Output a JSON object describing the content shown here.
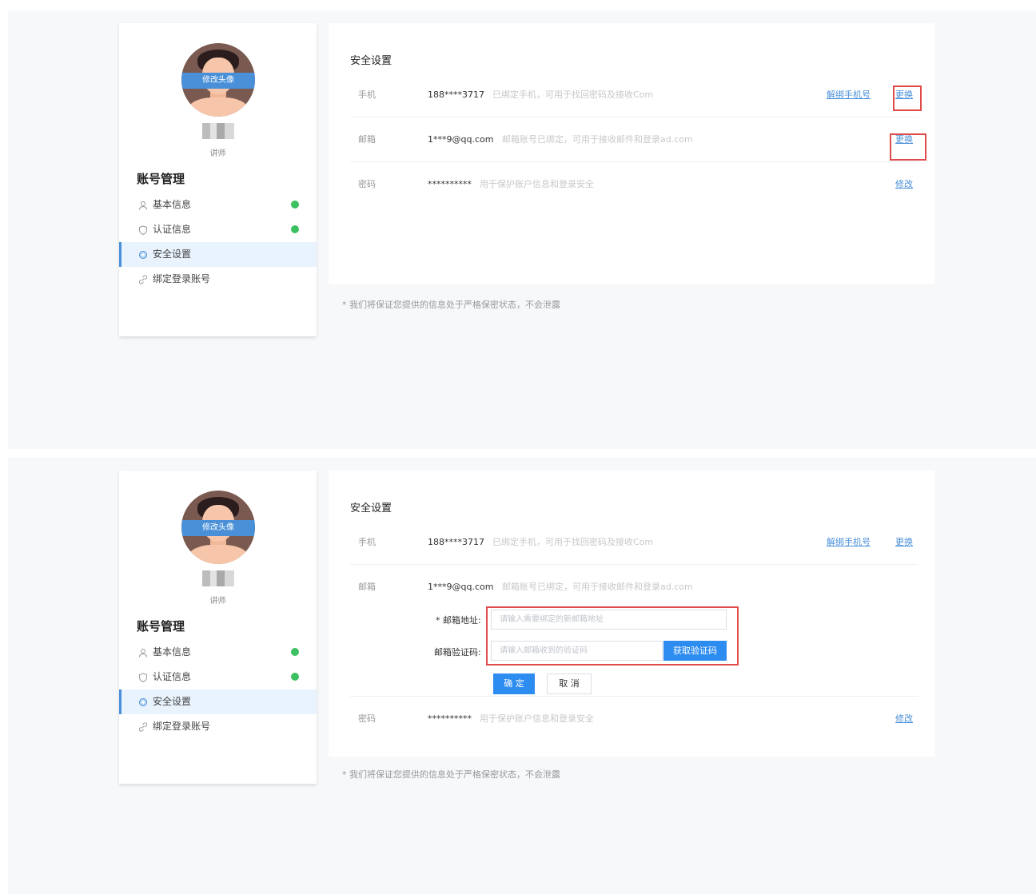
{
  "sidebar": {
    "avatar_badge": "修改头像",
    "name_sub": "讲师",
    "section_title": "账号管理",
    "items": [
      {
        "label": "基本信息",
        "verified": true
      },
      {
        "label": "认证信息",
        "verified": true
      },
      {
        "label": "安全设置",
        "active": true
      },
      {
        "label": "绑定登录账号"
      }
    ]
  },
  "security": {
    "title": "安全设置",
    "phone": {
      "label": "手机",
      "value": "188****3717",
      "desc": "已绑定手机，可用于找回密码及接收Com",
      "unbind_link": "解绑手机号",
      "change_link": "更换"
    },
    "email": {
      "label": "邮箱",
      "value": "1***9@qq.com",
      "desc": "邮箱账号已绑定，可用于接收邮件和登录ad.com",
      "change_link": "更换"
    },
    "password": {
      "label": "密码",
      "value": "**********",
      "desc": "用于保护账户信息和登录安全",
      "change_link": "修改"
    },
    "note": "* 我们将保证您提供的信息处于严格保密状态，不会泄露"
  },
  "email_form": {
    "address_label": "* 邮箱地址:",
    "address_placeholder": "请输入需要绑定的新邮箱地址",
    "code_label": "邮箱验证码:",
    "code_placeholder": "请输入邮箱收到的验证码",
    "get_code_button": "获取验证码",
    "confirm_button": "确 定",
    "cancel_button": "取 消"
  },
  "colors": {
    "accent": "#4a90d9",
    "highlight": "#e04b4b",
    "success": "#3cc061"
  }
}
